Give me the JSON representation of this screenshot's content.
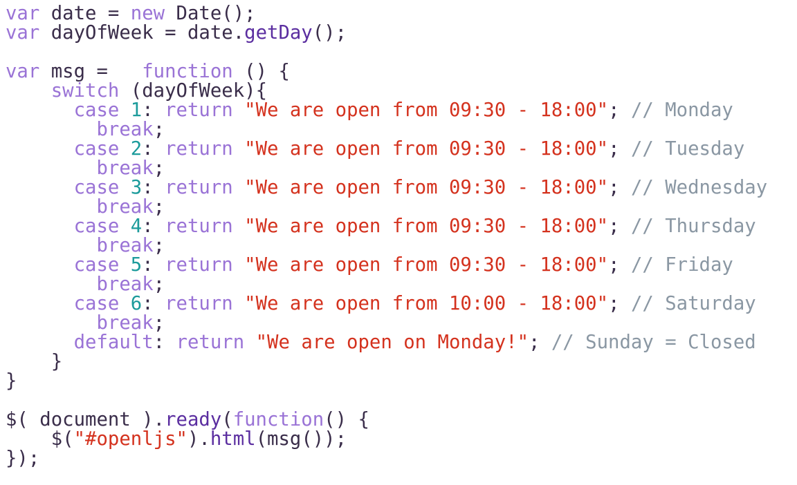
{
  "colors": {
    "background": "#ffffff",
    "keyword": "#9a73d6",
    "string": "#d4321e",
    "number": "#1c9b9b",
    "comment": "#8a97a3",
    "function": "#5b2ea0",
    "plain": "#3a2d4a"
  },
  "code": {
    "language": "javascript",
    "lines": [
      [
        [
          "keyword",
          "var"
        ],
        [
          "plain",
          " date = "
        ],
        [
          "keyword",
          "new"
        ],
        [
          "plain",
          " Date();"
        ]
      ],
      [
        [
          "keyword",
          "var"
        ],
        [
          "plain",
          " dayOfWeek = date."
        ],
        [
          "function",
          "getDay"
        ],
        [
          "plain",
          "();"
        ]
      ],
      [],
      [
        [
          "keyword",
          "var"
        ],
        [
          "plain",
          " msg =   "
        ],
        [
          "keyword",
          "function"
        ],
        [
          "plain",
          " () {"
        ]
      ],
      [
        [
          "plain",
          "    "
        ],
        [
          "keyword",
          "switch"
        ],
        [
          "plain",
          " (dayOfWeek){"
        ]
      ],
      [
        [
          "plain",
          "      "
        ],
        [
          "keyword",
          "case"
        ],
        [
          "plain",
          " "
        ],
        [
          "number",
          "1"
        ],
        [
          "plain",
          ": "
        ],
        [
          "keyword",
          "return"
        ],
        [
          "plain",
          " "
        ],
        [
          "string",
          "\"We are open from 09:30 - 18:00\""
        ],
        [
          "plain",
          "; "
        ],
        [
          "comment",
          "// Monday"
        ]
      ],
      [
        [
          "plain",
          "        "
        ],
        [
          "keyword",
          "break"
        ],
        [
          "plain",
          ";"
        ]
      ],
      [
        [
          "plain",
          "      "
        ],
        [
          "keyword",
          "case"
        ],
        [
          "plain",
          " "
        ],
        [
          "number",
          "2"
        ],
        [
          "plain",
          ": "
        ],
        [
          "keyword",
          "return"
        ],
        [
          "plain",
          " "
        ],
        [
          "string",
          "\"We are open from 09:30 - 18:00\""
        ],
        [
          "plain",
          "; "
        ],
        [
          "comment",
          "// Tuesday"
        ]
      ],
      [
        [
          "plain",
          "        "
        ],
        [
          "keyword",
          "break"
        ],
        [
          "plain",
          ";"
        ]
      ],
      [
        [
          "plain",
          "      "
        ],
        [
          "keyword",
          "case"
        ],
        [
          "plain",
          " "
        ],
        [
          "number",
          "3"
        ],
        [
          "plain",
          ": "
        ],
        [
          "keyword",
          "return"
        ],
        [
          "plain",
          " "
        ],
        [
          "string",
          "\"We are open from 09:30 - 18:00\""
        ],
        [
          "plain",
          "; "
        ],
        [
          "comment",
          "// Wednesday"
        ]
      ],
      [
        [
          "plain",
          "        "
        ],
        [
          "keyword",
          "break"
        ],
        [
          "plain",
          ";"
        ]
      ],
      [
        [
          "plain",
          "      "
        ],
        [
          "keyword",
          "case"
        ],
        [
          "plain",
          " "
        ],
        [
          "number",
          "4"
        ],
        [
          "plain",
          ": "
        ],
        [
          "keyword",
          "return"
        ],
        [
          "plain",
          " "
        ],
        [
          "string",
          "\"We are open from 09:30 - 18:00\""
        ],
        [
          "plain",
          "; "
        ],
        [
          "comment",
          "// Thursday"
        ]
      ],
      [
        [
          "plain",
          "        "
        ],
        [
          "keyword",
          "break"
        ],
        [
          "plain",
          ";"
        ]
      ],
      [
        [
          "plain",
          "      "
        ],
        [
          "keyword",
          "case"
        ],
        [
          "plain",
          " "
        ],
        [
          "number",
          "5"
        ],
        [
          "plain",
          ": "
        ],
        [
          "keyword",
          "return"
        ],
        [
          "plain",
          " "
        ],
        [
          "string",
          "\"We are open from 09:30 - 18:00\""
        ],
        [
          "plain",
          "; "
        ],
        [
          "comment",
          "// Friday"
        ]
      ],
      [
        [
          "plain",
          "        "
        ],
        [
          "keyword",
          "break"
        ],
        [
          "plain",
          ";"
        ]
      ],
      [
        [
          "plain",
          "      "
        ],
        [
          "keyword",
          "case"
        ],
        [
          "plain",
          " "
        ],
        [
          "number",
          "6"
        ],
        [
          "plain",
          ": "
        ],
        [
          "keyword",
          "return"
        ],
        [
          "plain",
          " "
        ],
        [
          "string",
          "\"We are open from 10:00 - 18:00\""
        ],
        [
          "plain",
          "; "
        ],
        [
          "comment",
          "// Saturday"
        ]
      ],
      [
        [
          "plain",
          "        "
        ],
        [
          "keyword",
          "break"
        ],
        [
          "plain",
          ";"
        ]
      ],
      [
        [
          "plain",
          "      "
        ],
        [
          "keyword",
          "default"
        ],
        [
          "plain",
          ": "
        ],
        [
          "keyword",
          "return"
        ],
        [
          "plain",
          " "
        ],
        [
          "string",
          "\"We are open on Monday!\""
        ],
        [
          "plain",
          "; "
        ],
        [
          "comment",
          "// Sunday = Closed"
        ]
      ],
      [
        [
          "plain",
          "    }"
        ]
      ],
      [
        [
          "plain",
          "}"
        ]
      ],
      [],
      [
        [
          "plain",
          "$( document )."
        ],
        [
          "function",
          "ready"
        ],
        [
          "plain",
          "("
        ],
        [
          "keyword",
          "function"
        ],
        [
          "plain",
          "() {"
        ]
      ],
      [
        [
          "plain",
          "    $("
        ],
        [
          "string",
          "\"#openljs\""
        ],
        [
          "plain",
          ")."
        ],
        [
          "function",
          "html"
        ],
        [
          "plain",
          "(msg());"
        ]
      ],
      [
        [
          "plain",
          "});"
        ]
      ]
    ]
  }
}
